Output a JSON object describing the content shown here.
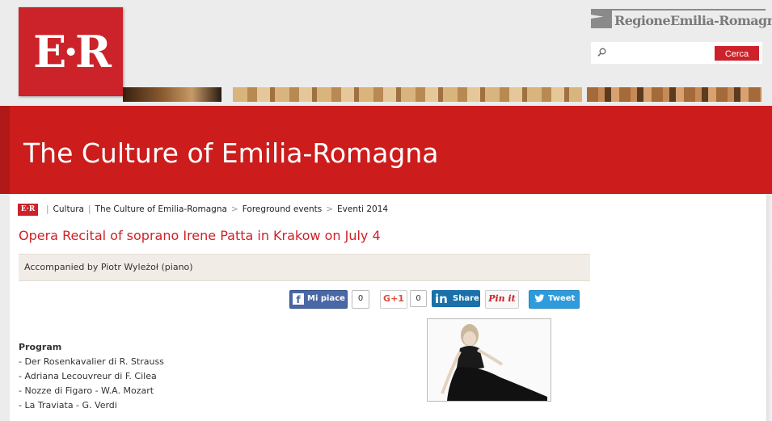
{
  "header": {
    "logo_text": "E·R",
    "region_name": "RegioneEmilia-Romagna",
    "search": {
      "placeholder": "",
      "button_label": "Cerca"
    }
  },
  "hero": {
    "title": "The Culture of Emilia-Romagna"
  },
  "breadcrumb": {
    "logo_text": "E·R",
    "items": [
      "Cultura",
      "The Culture of Emilia-Romagna",
      "Foreground events",
      "Eventi 2014"
    ]
  },
  "article": {
    "title": "Opera Recital of soprano Irene Patta in Krakow on July 4",
    "subtitle": "Accompanied by Piotr Wyleżoł (piano)",
    "program_heading": "Program",
    "program_items": [
      "- Der Rosenkavalier di R. Strauss",
      "- Adriana Lecouvreur di F. Cilea",
      "- Nozze di Figaro - W.A. Mozart",
      "- La Traviata - G. Verdi"
    ]
  },
  "social": {
    "facebook_label": "Mi piace",
    "facebook_icon": "f",
    "facebook_count": "0",
    "gplus_label": "G+1",
    "gplus_count": "0",
    "linkedin_icon": "in",
    "linkedin_label": "Share",
    "pinterest_label": "Pin it",
    "twitter_label": "Tweet"
  },
  "colors": {
    "brand_red": "#cc2229",
    "hero_red": "#cc1c1c",
    "subtitle_bg": "#f1ece6"
  }
}
